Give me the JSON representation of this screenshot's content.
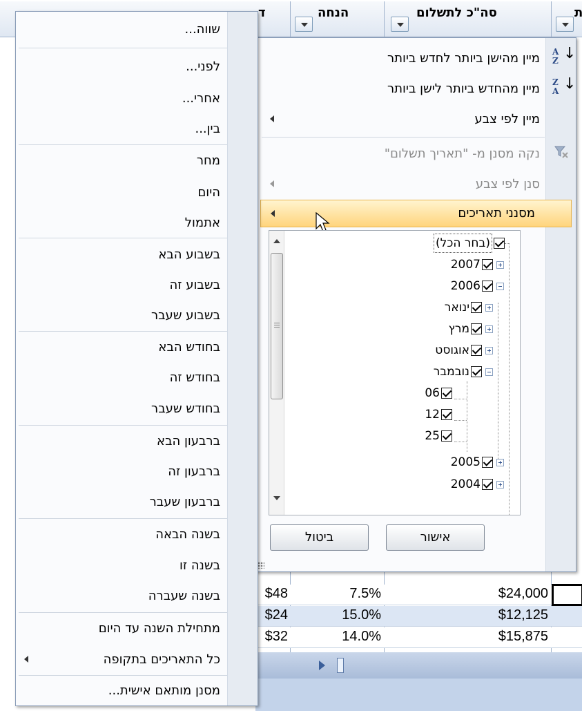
{
  "sheet": {
    "headers": [
      {
        "id": "h1",
        "text": "ד"
      },
      {
        "id": "h2",
        "text": "הנחה"
      },
      {
        "id": "h3",
        "text": "סה\"כ לתשלום"
      },
      {
        "id": "h4",
        "text": "ת"
      }
    ],
    "rows": [
      {
        "a": "$48",
        "b": "7.5%",
        "c": "$24,000"
      },
      {
        "a": "$24",
        "b": "15.0%",
        "c": "$12,125"
      },
      {
        "a": "$32",
        "b": "14.0%",
        "c": "$15,875"
      }
    ]
  },
  "filter": {
    "sort_old_new": "מיין מהישן ביותר לחדש ביותר",
    "sort_new_old": "מיין מהחדש ביותר לישן ביותר",
    "sort_by_color": "מיין לפי צבע",
    "clear_filter": "נקה מסנן מ- \"תאריך תשלום\"",
    "filter_by_color": "סנן לפי צבע",
    "date_filters": "מסנני תאריכים",
    "tree": {
      "select_all": "(בחר הכל)",
      "y2007": "2007",
      "y2006": "2006",
      "jan": "ינואר",
      "mar": "מרץ",
      "aug": "אוגוסט",
      "nov": "נובמבר",
      "d06": "06",
      "d12": "12",
      "d25": "25",
      "y2005": "2005",
      "y2004": "2004"
    },
    "ok": "אישור",
    "cancel": "ביטול"
  },
  "date_menu": {
    "items": [
      "שווה...",
      "לפני...",
      "אחרי...",
      "בין...",
      "מחר",
      "היום",
      "אתמול",
      "בשבוע הבא",
      "בשבוע זה",
      "בשבוע שעבר",
      "בחודש הבא",
      "בחודש זה",
      "בחודש שעבר",
      "ברבעון הבא",
      "ברבעון זה",
      "ברבעון שעבר",
      "בשנה הבאה",
      "בשנה זו",
      "בשנה שעברה",
      "מתחילת השנה עד היום",
      "כל התאריכים בתקופה",
      "מסנן מותאם אישית..."
    ]
  }
}
